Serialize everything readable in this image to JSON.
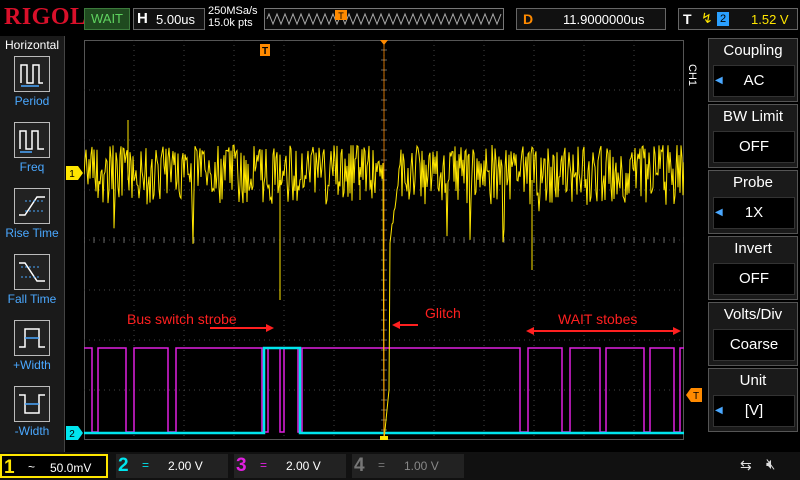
{
  "header": {
    "brand": "RIGOL",
    "run_status": "WAIT",
    "timebase_label": "H",
    "timebase_value": "5.00us",
    "sample_rate": "250MSa/s",
    "memory_depth": "15.0k pts",
    "trigger_marker": "T",
    "delay_label": "D",
    "delay_value": "11.9000000us",
    "trigger_label": "T",
    "trigger_edge": "↯",
    "trigger_source": "2",
    "trigger_level": "1.52 V"
  },
  "left_menu": {
    "title": "Horizontal",
    "items": [
      {
        "label": "Period"
      },
      {
        "label": "Freq"
      },
      {
        "label": "Rise Time"
      },
      {
        "label": "Fall Time"
      },
      {
        "label": "+Width"
      },
      {
        "label": "-Width"
      }
    ]
  },
  "right_menu": {
    "channel": "CH1",
    "buttons": [
      {
        "title": "Coupling",
        "value": "AC"
      },
      {
        "title": "BW Limit",
        "value": "OFF"
      },
      {
        "title": "Probe",
        "value": "1X"
      },
      {
        "title": "Invert",
        "value": "OFF"
      },
      {
        "title": "Volts/Div",
        "value": "Coarse"
      },
      {
        "title": "Unit",
        "value": "[V]"
      }
    ]
  },
  "annotations": {
    "bus_strobe": "Bus switch strobe",
    "glitch": "Glitch",
    "wait_strobes": "WAIT stobes"
  },
  "channel_markers": {
    "ch1": "1",
    "ch2": "2",
    "trigger_level": "T"
  },
  "channels": [
    {
      "num": "1",
      "coupling": "~",
      "scale": "50.0mV",
      "color": "#ffe600"
    },
    {
      "num": "2",
      "coupling": "=",
      "scale": "2.00 V",
      "color": "#00e5ee"
    },
    {
      "num": "3",
      "coupling": "=",
      "scale": "2.00 V",
      "color": "#e020e0"
    },
    {
      "num": "4",
      "coupling": "=",
      "scale": "1.00 V",
      "color": "#3b5bd8"
    }
  ],
  "colors": {
    "ch1": "#ffe600",
    "ch2": "#00e5ee",
    "ch3": "#e020e0",
    "accent": "#ff8a00",
    "menu_blue": "#4aa8ff"
  }
}
